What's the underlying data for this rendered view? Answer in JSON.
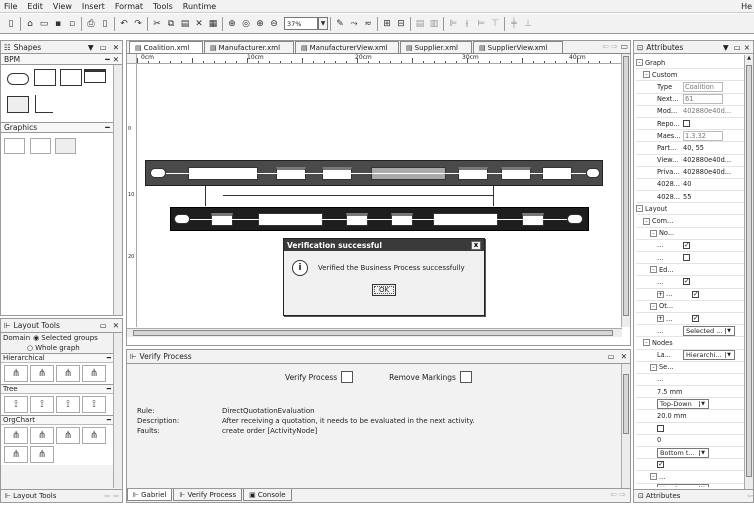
{
  "menubar": {
    "items": [
      "File",
      "Edit",
      "View",
      "Insert",
      "Format",
      "Tools",
      "Runtime"
    ],
    "right_label": "He"
  },
  "toolbar": {
    "zoom_value": "37%"
  },
  "shapes_panel": {
    "title": "Shapes",
    "bpm_title": "BPM",
    "graphics_title": "Graphics"
  },
  "layout_tools": {
    "title": "Layout Tools",
    "domain_label": "Domain",
    "option_selected": "Selected groups",
    "option_whole": "Whole graph",
    "sections": [
      "Hierarchical",
      "Tree",
      "OrgChart"
    ],
    "footer_label": "Layout Tools"
  },
  "editor_tabs": [
    {
      "label": "Coalition.xml",
      "active": true
    },
    {
      "label": "Manufacturer.xml",
      "active": false
    },
    {
      "label": "ManufacturerView.xml",
      "active": false
    },
    {
      "label": "Supplier.xml",
      "active": false
    },
    {
      "label": "SupplierView.xml",
      "active": false
    }
  ],
  "ruler": {
    "h_labels": [
      "0cm",
      "10cm",
      "20cm",
      "30cm",
      "40cm"
    ],
    "v_labels": [
      "0",
      "10",
      "20"
    ]
  },
  "dialog": {
    "title": "Verification successful",
    "message": "Verified the Business Process successfully",
    "ok_label": "OK",
    "close_label": "x"
  },
  "verify_panel": {
    "title": "Verify Process",
    "verify_label": "Verify Process",
    "remove_label": "Remove Markings",
    "rule_label": "Rule:",
    "rule_value": "DirectQuotationEvaluation",
    "desc_label": "Description:",
    "desc_value": "After receiving a quotation, it needs to be evaluated in the next activity.",
    "faults_label": "Faults:",
    "faults_value": "create order [ActivityNode]"
  },
  "bottom_tabs": [
    "Gabriel",
    "Verify Process",
    "Console"
  ],
  "attributes": {
    "title": "Attributes",
    "footer_label": "Attributes",
    "rows": [
      {
        "indent": 0,
        "toggle": "-",
        "key": "Graph",
        "value": ""
      },
      {
        "indent": 1,
        "toggle": "-",
        "key": "Custom",
        "value": ""
      },
      {
        "indent": 3,
        "toggle": "",
        "key": "Type",
        "value": "Coalition",
        "kind": "field"
      },
      {
        "indent": 3,
        "toggle": "",
        "key": "Next...",
        "value": "61",
        "kind": "field"
      },
      {
        "indent": 3,
        "toggle": "",
        "key": "Mod...",
        "value": "402880e40d...",
        "kind": "text"
      },
      {
        "indent": 3,
        "toggle": "",
        "key": "Repo...",
        "value": "",
        "kind": "check-off"
      },
      {
        "indent": 3,
        "toggle": "",
        "key": "Maes...",
        "value": "1.3.32",
        "kind": "field"
      },
      {
        "indent": 3,
        "toggle": "",
        "key": "Part...",
        "value": "40, 55",
        "kind": "text-dark"
      },
      {
        "indent": 3,
        "toggle": "",
        "key": "View...",
        "value": "402880e40d...",
        "kind": "text-dark"
      },
      {
        "indent": 3,
        "toggle": "",
        "key": "Priva...",
        "value": "402880e40d...",
        "kind": "text-dark"
      },
      {
        "indent": 3,
        "toggle": "",
        "key": "4028...",
        "value": "40",
        "kind": "text-dark"
      },
      {
        "indent": 3,
        "toggle": "",
        "key": "4028...",
        "value": "55",
        "kind": "text-dark"
      },
      {
        "indent": 0,
        "toggle": "-",
        "key": "Layout",
        "value": ""
      },
      {
        "indent": 1,
        "toggle": "-",
        "key": "Com...",
        "value": ""
      },
      {
        "indent": 2,
        "toggle": "-",
        "key": "No...",
        "value": ""
      },
      {
        "indent": 3,
        "toggle": "",
        "key": "...",
        "value": "",
        "kind": "check-on"
      },
      {
        "indent": 3,
        "toggle": "",
        "key": "...",
        "value": "",
        "kind": "check-off"
      },
      {
        "indent": 2,
        "toggle": "-",
        "key": "Ed...",
        "value": ""
      },
      {
        "indent": 3,
        "toggle": "",
        "key": "...",
        "value": "",
        "kind": "check-on"
      },
      {
        "indent": 3,
        "toggle": "+",
        "key": "...",
        "value": "",
        "kind": "check-on"
      },
      {
        "indent": 2,
        "toggle": "-",
        "key": "Ot...",
        "value": ""
      },
      {
        "indent": 3,
        "toggle": "+",
        "key": "...",
        "value": "",
        "kind": "check-on"
      },
      {
        "indent": 3,
        "toggle": "",
        "key": "...",
        "value": "Selected ...",
        "kind": "select"
      },
      {
        "indent": 1,
        "toggle": "-",
        "key": "Nodes",
        "value": ""
      },
      {
        "indent": 3,
        "toggle": "",
        "key": "La...",
        "value": "Hierarchi...",
        "kind": "select"
      },
      {
        "indent": 2,
        "toggle": "-",
        "key": "Se...",
        "value": ""
      },
      {
        "indent": 3,
        "toggle": "",
        "key": "...",
        "value": "",
        "kind": "text"
      },
      {
        "indent": 3,
        "toggle": "",
        "key": "",
        "value": "7.5 mm",
        "kind": "text-dark"
      },
      {
        "indent": 3,
        "toggle": "",
        "key": "",
        "value": "Top-Down",
        "kind": "select"
      },
      {
        "indent": 3,
        "toggle": "",
        "key": "",
        "value": "20.0 mm",
        "kind": "text-dark"
      },
      {
        "indent": 3,
        "toggle": "",
        "key": "",
        "value": "",
        "kind": "check-off"
      },
      {
        "indent": 3,
        "toggle": "",
        "key": "",
        "value": "0",
        "kind": "text-dark"
      },
      {
        "indent": 3,
        "toggle": "",
        "key": "",
        "value": "Bottom t...",
        "kind": "select"
      },
      {
        "indent": 3,
        "toggle": "",
        "key": "",
        "value": "",
        "kind": "check-on"
      },
      {
        "indent": 2,
        "toggle": "-",
        "key": "...",
        "value": ""
      },
      {
        "indent": 3,
        "toggle": "",
        "key": "",
        "value": "Head",
        "kind": "select"
      }
    ]
  }
}
